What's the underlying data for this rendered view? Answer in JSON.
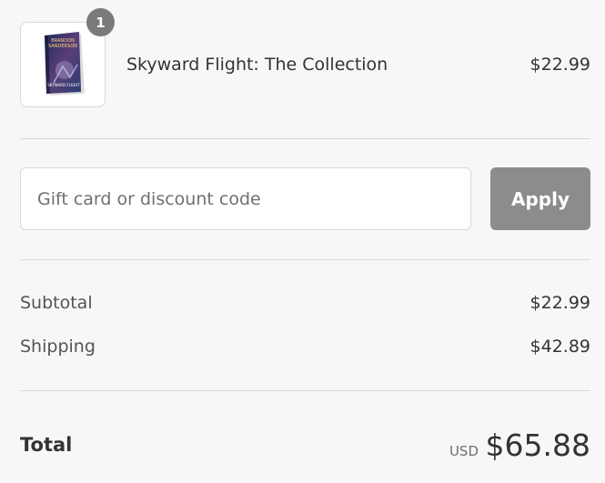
{
  "cart": {
    "items": [
      {
        "quantity": "1",
        "title": "Skyward Flight: The Collection",
        "price": "$22.99",
        "cover_text": [
          "BRANDON",
          "SANDERSON",
          "SKYWARD FLIGHT"
        ],
        "image_icon": "book-cover-icon"
      }
    ]
  },
  "discount": {
    "placeholder": "Gift card or discount code",
    "value": "",
    "apply_label": "Apply"
  },
  "summary": {
    "subtotal_label": "Subtotal",
    "subtotal_value": "$22.99",
    "shipping_label": "Shipping",
    "shipping_value": "$42.89",
    "total_label": "Total",
    "currency": "USD",
    "total_value": "$65.88"
  },
  "colors": {
    "background": "#f7f7f7",
    "badge": "#7a7a7a",
    "apply_button": "#8c8c8c",
    "divider": "#d9d9d9",
    "text": "#333333"
  }
}
